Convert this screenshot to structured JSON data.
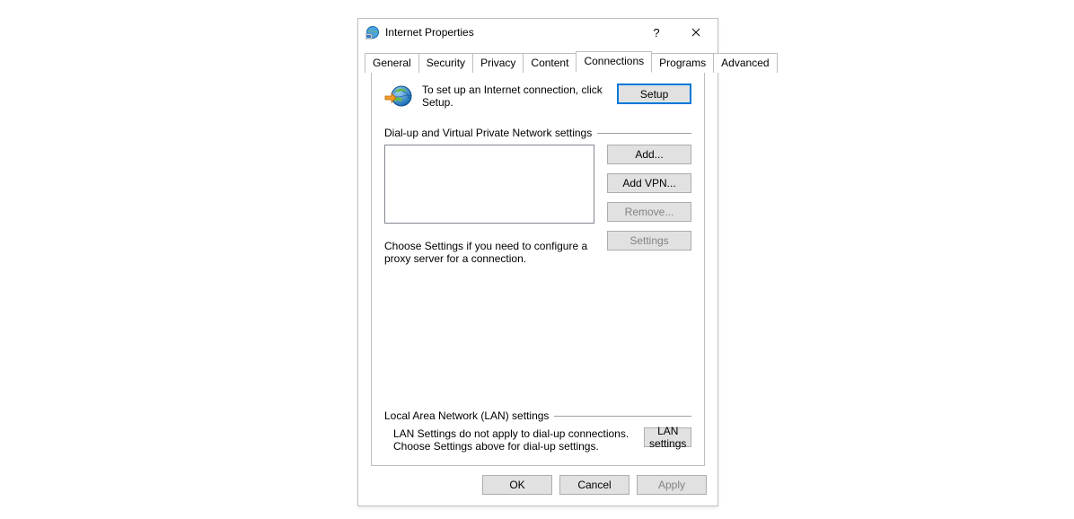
{
  "window": {
    "title": "Internet Properties",
    "help_tooltip": "?",
    "close_tooltip": "Close"
  },
  "tabs": [
    {
      "label": "General",
      "selected": false
    },
    {
      "label": "Security",
      "selected": false
    },
    {
      "label": "Privacy",
      "selected": false
    },
    {
      "label": "Content",
      "selected": false
    },
    {
      "label": "Connections",
      "selected": true
    },
    {
      "label": "Programs",
      "selected": false
    },
    {
      "label": "Advanced",
      "selected": false
    }
  ],
  "intro": {
    "text": "To set up an Internet connection, click Setup.",
    "setup_button": "Setup"
  },
  "dialup": {
    "group_label": "Dial-up and Virtual Private Network settings",
    "add_button": "Add...",
    "add_vpn_button": "Add VPN...",
    "remove_button": "Remove...",
    "remove_enabled": false,
    "settings_button": "Settings",
    "settings_enabled": false,
    "settings_desc": "Choose Settings if you need to configure a proxy server for a connection."
  },
  "lan": {
    "group_label": "Local Area Network (LAN) settings",
    "desc": "LAN Settings do not apply to dial-up connections. Choose Settings above for dial-up settings.",
    "button": "LAN settings"
  },
  "actions": {
    "ok": "OK",
    "cancel": "Cancel",
    "apply": "Apply",
    "apply_enabled": false
  }
}
